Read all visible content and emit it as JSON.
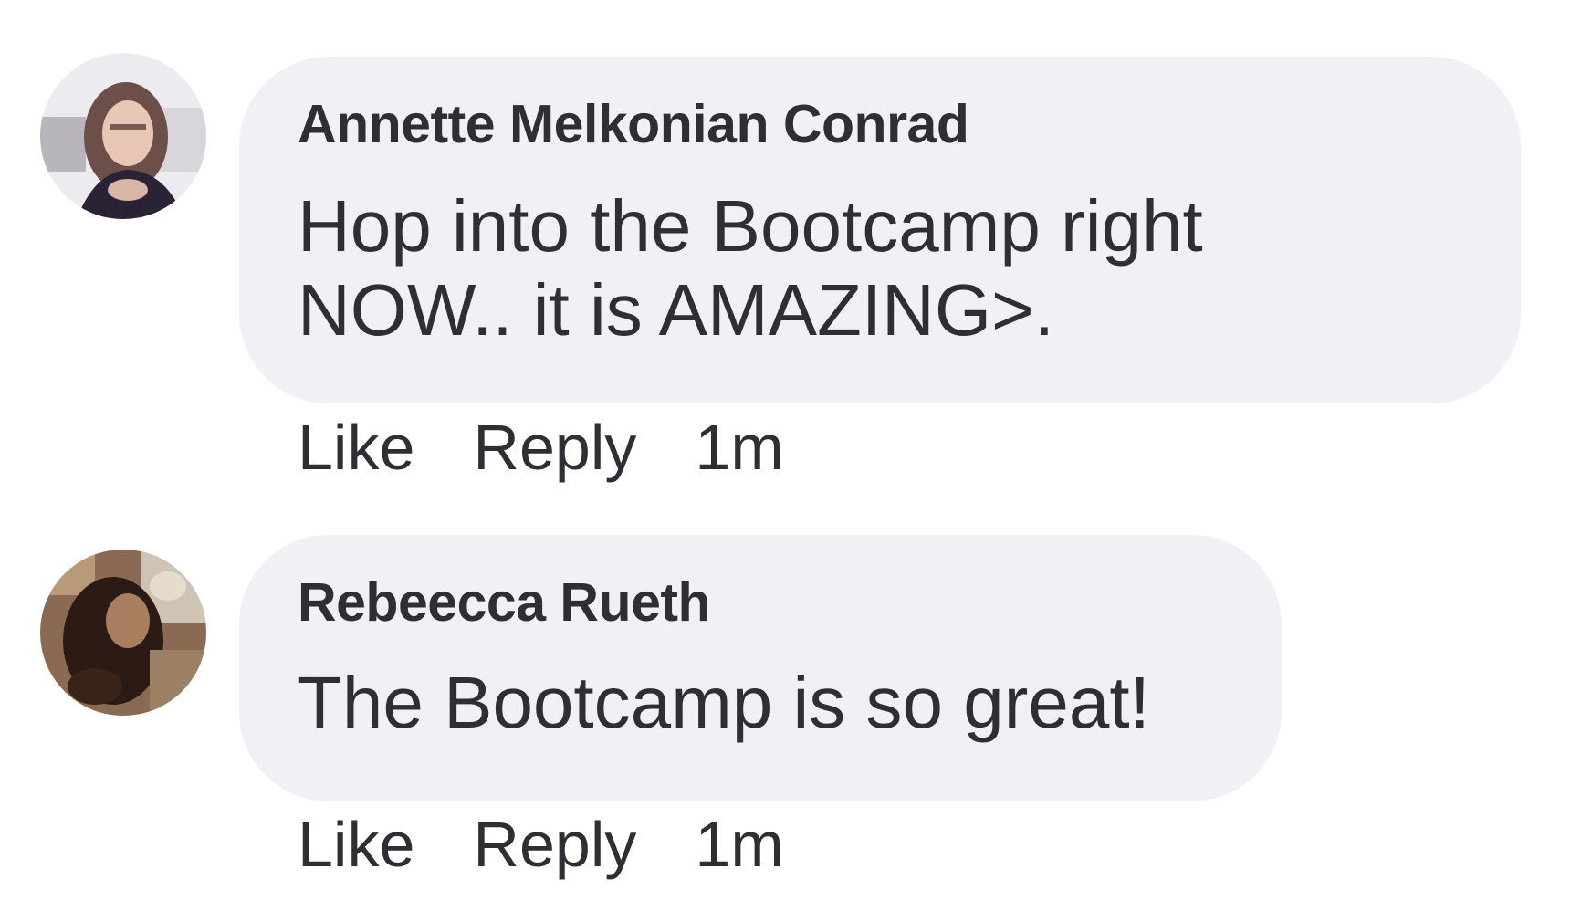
{
  "comments": [
    {
      "author": "Annette Melkonian Conrad",
      "text_lines": [
        "Hop into the Bootcamp right",
        "NOW.. it is AMAZING>."
      ],
      "actions": {
        "like": "Like",
        "reply": "Reply",
        "time": "1m"
      },
      "avatar_icon": "profile-photo-woman-long-hair"
    },
    {
      "author": "Rebeecca Rueth",
      "text_lines": [
        "The Bootcamp is so great!"
      ],
      "actions": {
        "like": "Like",
        "reply": "Reply",
        "time": "1m"
      },
      "avatar_icon": "profile-photo-person"
    }
  ],
  "colors": {
    "bubble": "#f0f1f4",
    "text": "#2e2f32",
    "background": "#ffffff"
  }
}
